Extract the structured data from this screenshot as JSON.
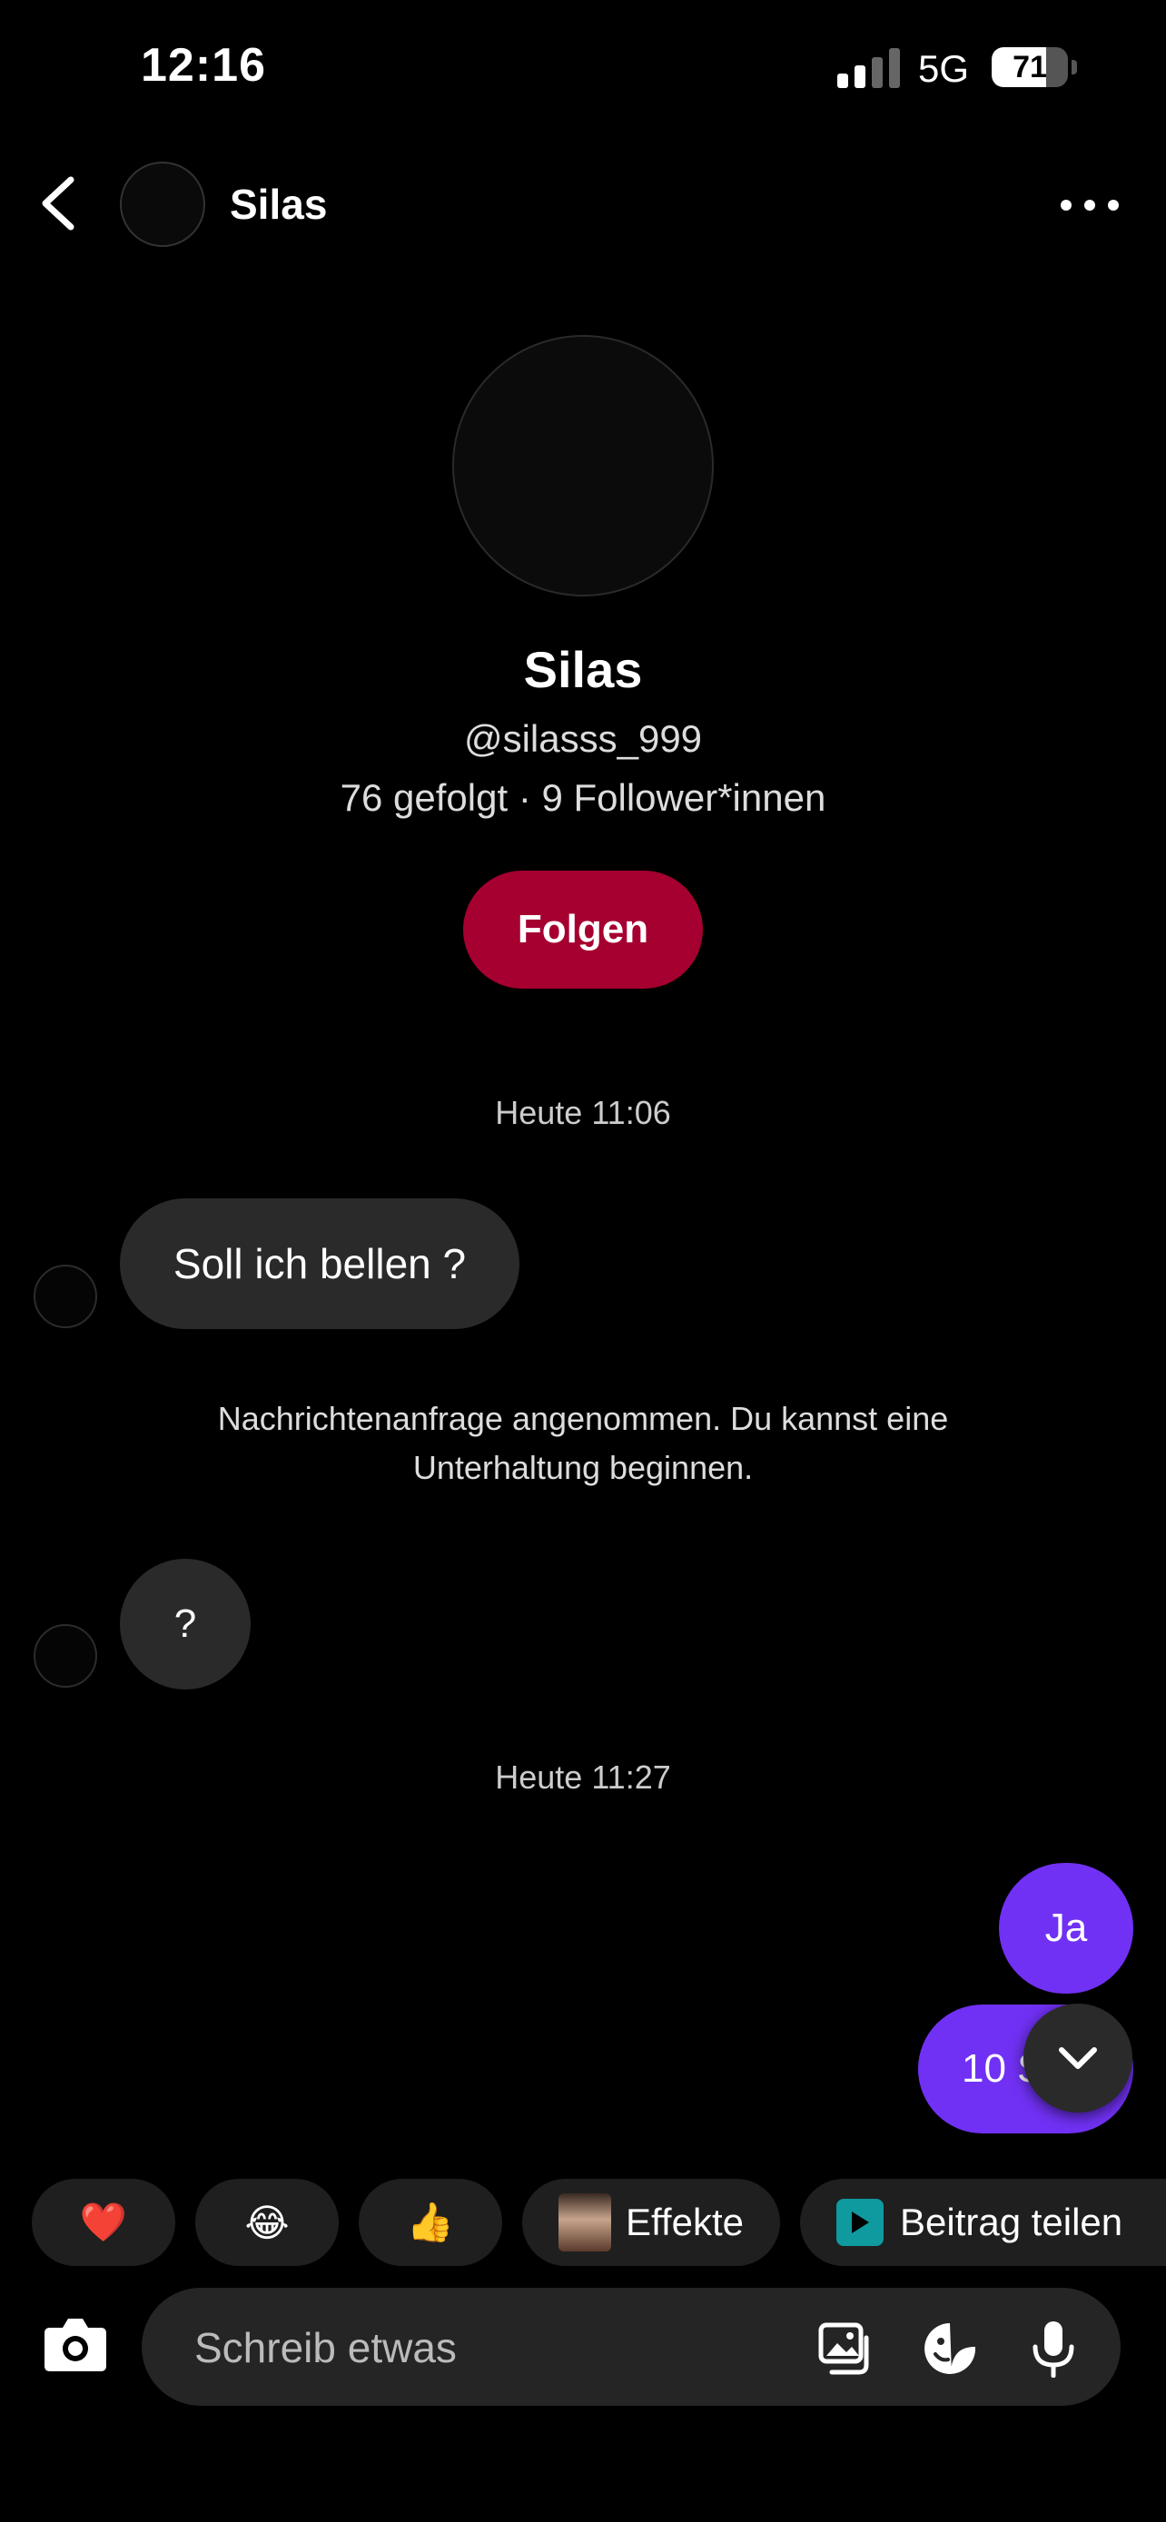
{
  "status_bar": {
    "time": "12:16",
    "network": "5G",
    "battery": "71",
    "battery_level": 0.71
  },
  "header": {
    "name": "Silas"
  },
  "profile": {
    "name": "Silas",
    "handle": "@silasss_999",
    "stats": "76 gefolgt · 9 Follower*innen",
    "follow_label": "Folgen"
  },
  "chat": {
    "timestamp_1": "Heute 11:06",
    "incoming_1": "Soll ich bellen ?",
    "system_note_line1": "Nachrichtenanfrage angenommen. Du kannst eine",
    "system_note_line2": "Unterhaltung beginnen.",
    "incoming_2": "?",
    "timestamp_2": "Heute 11:27",
    "outgoing_1": "Ja",
    "outgoing_2_visible": "10 S"
  },
  "quick_reactions": {
    "heart": "❤️",
    "laugh": "😂",
    "thumbs_up": "👍",
    "effects_label": "Effekte",
    "share_label": "Beitrag teilen"
  },
  "composer": {
    "placeholder": "Schreib etwas"
  },
  "colors": {
    "background": "#000000",
    "follow_button": "#a50030",
    "outgoing_bubble": "#7131f5",
    "incoming_bubble": "#2a2a2a"
  },
  "icons": [
    "signal-icon",
    "battery-icon",
    "back-icon",
    "more-icon",
    "chevron-down-icon",
    "play-icon",
    "camera-icon",
    "image-icon",
    "sticker-icon",
    "mic-icon"
  ]
}
